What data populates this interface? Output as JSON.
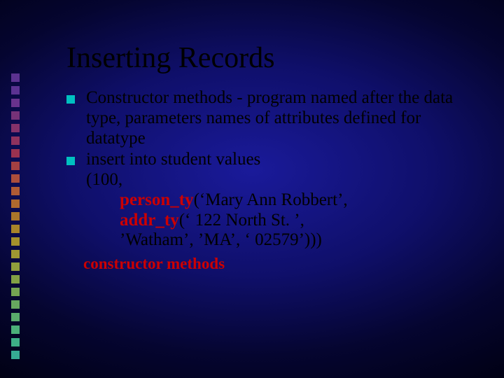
{
  "slide": {
    "title": "Inserting Records",
    "bullets": [
      {
        "text": "Constructor methods - program named after the data type, parameters names of attributes defined for datatype"
      },
      {
        "text": "insert into student values",
        "lines": [
          "(100,",
          {
            "bold": "person_ty",
            "rest": "(‘Mary Ann Robbert’,"
          },
          {
            "bold": "addr_ty",
            "rest": "(‘ 122 North St. ’,"
          },
          "’Watham’, ’MA’, ‘ 02579’)))"
        ]
      }
    ],
    "footer": "constructor methods"
  },
  "decor": {
    "colors": [
      "#6a3aa0",
      "#6a3aa0",
      "#7a3a9a",
      "#8a3a80",
      "#9a3a70",
      "#a83a60",
      "#b43a50",
      "#c04a40",
      "#c85a38",
      "#cc6a30",
      "#cc7a28",
      "#c88a24",
      "#c49a24",
      "#c0a828",
      "#b8b030",
      "#a8b83c",
      "#98bc48",
      "#88c058",
      "#78c468",
      "#68c878",
      "#58cc88",
      "#48cc98",
      "#40c8a8"
    ]
  }
}
